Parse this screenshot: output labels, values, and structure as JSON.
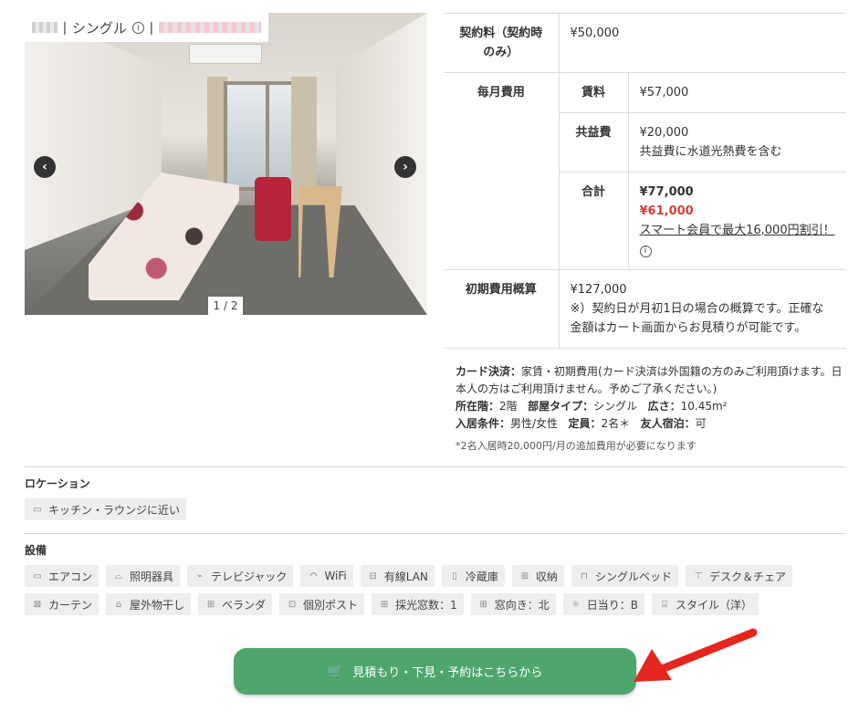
{
  "photo": {
    "caption_type": "シングル",
    "info_icon": "info-icon",
    "counter": "1 / 2",
    "prev_icon": "chevron-left-icon",
    "next_icon": "chevron-right-icon"
  },
  "pricing": {
    "contract_fee": {
      "label": "契約料（契約時のみ）",
      "value": "¥50,000"
    },
    "monthly": {
      "label": "毎月費用",
      "rent": {
        "label": "賃料",
        "value": "¥57,000"
      },
      "common": {
        "label": "共益費",
        "value": "¥20,000",
        "note": "共益費に水道光熱費を含む"
      },
      "total": {
        "label": "合計",
        "value": "¥77,000",
        "discount": "¥61,000",
        "smart_link": "スマート会員で最大16,000円割引！"
      }
    },
    "initial": {
      "label": "初期費用概算",
      "value": "¥127,000",
      "note": "※）契約日が月初1日の場合の概算です。正確な金額はカート画面からお見積りが可能です。"
    }
  },
  "notes": {
    "card_label": "カード決済：",
    "card_text": "家賃・初期費用(カード決済は外国籍の方のみご利用頂けます。日本人の方はご利用頂けません。予めご了承ください。)",
    "floor_label": "所在階：",
    "floor_value": "2階",
    "room_type_label": "部屋タイプ：",
    "room_type_value": "シングル",
    "area_label": "広さ：",
    "area_value": "10.45m²",
    "condition_label": "入居条件：",
    "condition_value": "男性/女性",
    "capacity_label": "定員：",
    "capacity_value": "2名＊",
    "friend_label": "友人宿泊：",
    "friend_value": "可",
    "small_note": "*2名入居時20,000円/月の追加費用が必要になります"
  },
  "location": {
    "title": "ロケーション",
    "tags": [
      {
        "label": "キッチン・ラウンジに近い",
        "icon": "sofa-icon"
      }
    ]
  },
  "facilities": {
    "title": "設備",
    "tags": [
      {
        "label": "エアコン",
        "icon": "aircon-icon"
      },
      {
        "label": "照明器具",
        "icon": "lamp-icon"
      },
      {
        "label": "テレビジャック",
        "icon": "tv-jack-icon"
      },
      {
        "label": "WiFi",
        "icon": "wifi-icon"
      },
      {
        "label": "有線LAN",
        "icon": "lan-icon"
      },
      {
        "label": "冷蔵庫",
        "icon": "fridge-icon"
      },
      {
        "label": "収納",
        "icon": "storage-icon"
      },
      {
        "label": "シングルベッド",
        "icon": "bed-icon"
      },
      {
        "label": "デスク＆チェア",
        "icon": "desk-icon"
      },
      {
        "label": "カーテン",
        "icon": "curtain-icon"
      },
      {
        "label": "屋外物干し",
        "icon": "laundry-icon"
      },
      {
        "label": "ベランダ",
        "icon": "balcony-icon"
      },
      {
        "label": "個別ポスト",
        "icon": "mailbox-icon"
      },
      {
        "label": "採光窓数：1",
        "icon": "window-icon"
      },
      {
        "label": "窓向き：北",
        "icon": "window-direction-icon"
      },
      {
        "label": "日当り：B",
        "icon": "sun-icon"
      },
      {
        "label": "スタイル（洋）",
        "icon": "style-icon"
      }
    ]
  },
  "cta": {
    "label": "見積もり・下見・予約はこちらから",
    "icon": "cart-icon",
    "color": "#4fa66d"
  },
  "colors": {
    "discount": "#d0413b",
    "arrow": "#e5261f"
  }
}
